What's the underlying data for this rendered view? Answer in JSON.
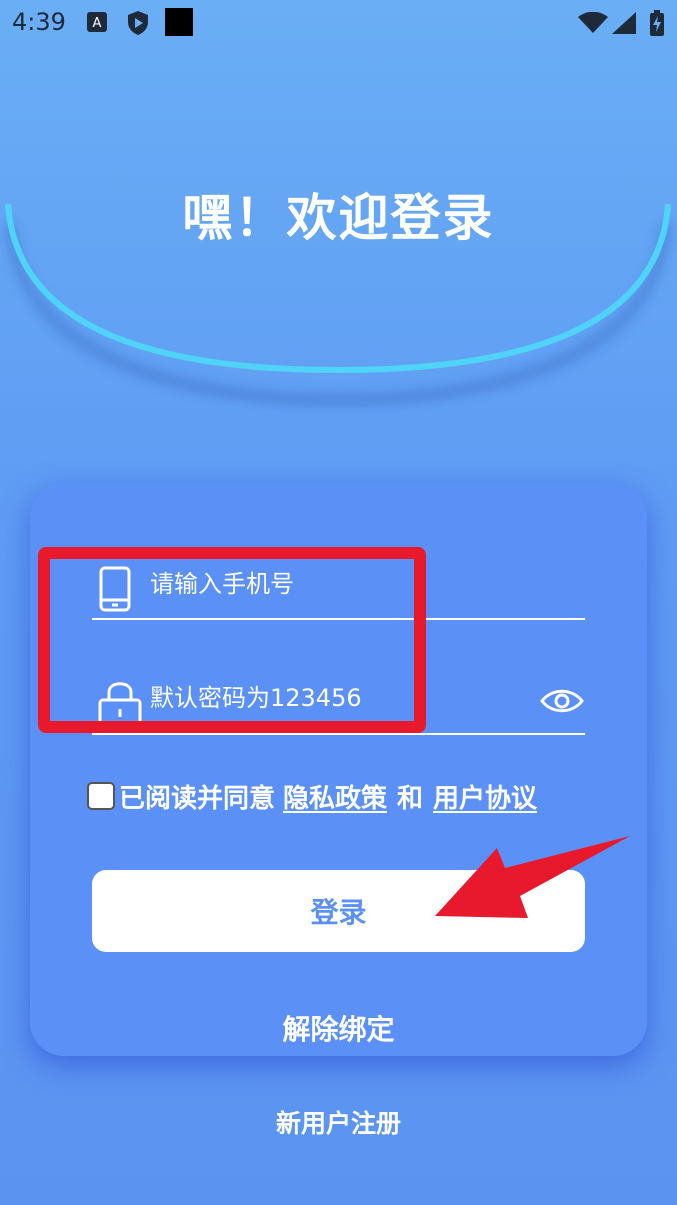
{
  "status_bar": {
    "time": "4:39",
    "icons": [
      "font-a-icon",
      "shield-play-icon",
      "black-square-icon",
      "wifi-icon",
      "signal-icon",
      "battery-charging-icon"
    ]
  },
  "header": {
    "title": "嘿！欢迎登录"
  },
  "form": {
    "phone_placeholder": "请输入手机号",
    "password_placeholder": "默认密码为123456",
    "agreement_prefix": "已阅读并同意",
    "privacy_link": "隐私政策",
    "conjunction": "和",
    "user_agreement_link": "用户协议",
    "login_label": "登录",
    "unbind_label": "解除绑定"
  },
  "footer": {
    "register_label": "新用户注册"
  },
  "colors": {
    "background": "#5f9cf4",
    "card": "#5b90f6",
    "arc": "#4fd3f7",
    "annotation_red": "#e8192c",
    "button_text": "#5b90f6"
  }
}
